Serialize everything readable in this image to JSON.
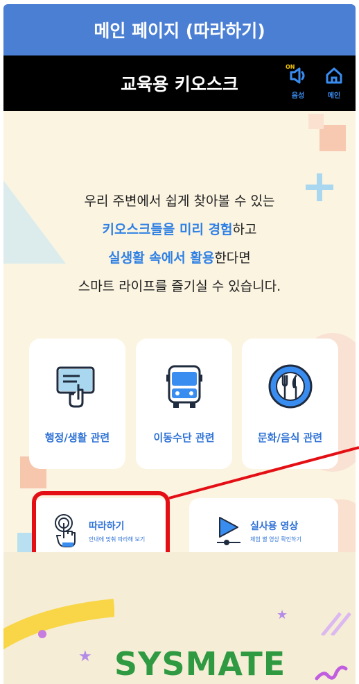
{
  "window": {
    "title": "메인 페이지 (따라하기)"
  },
  "header": {
    "title": "교육용 키오스크",
    "sound": {
      "badge": "ON",
      "label": "음성"
    },
    "home": {
      "label": "메인"
    }
  },
  "intro": {
    "line1": "우리 주변에서 쉽게 찾아볼 수 있는",
    "line2_highlight": "키오스크들을 미리 경험",
    "line2_rest": "하고",
    "line3_highlight": "실생활 속에서 활용",
    "line3_rest": "한다면",
    "line4": "스마트 라이프를 즐기실 수 있습니다."
  },
  "categories": [
    {
      "label": "행정/생활 관련",
      "icon": "card-hand-icon"
    },
    {
      "label": "이동수단 관련",
      "icon": "bus-icon"
    },
    {
      "label": "문화/음식 관련",
      "icon": "fork-knife-icon"
    }
  ],
  "actions": {
    "follow": {
      "title": "따라하기",
      "subtitle": "안내에 맞춰 따라해 보기",
      "icon": "touch-hand-icon"
    },
    "video": {
      "title": "실사용 영상",
      "subtitle": "체험 별 영상 확인하기",
      "icon": "play-icon"
    }
  },
  "footer": {
    "logo": "SYSMATE"
  },
  "colors": {
    "title_bar": "#4a7fd4",
    "accent": "#2f72d6",
    "highlight": "#2f80e4",
    "background": "#fbf4e1",
    "callout": "#e40f14"
  }
}
